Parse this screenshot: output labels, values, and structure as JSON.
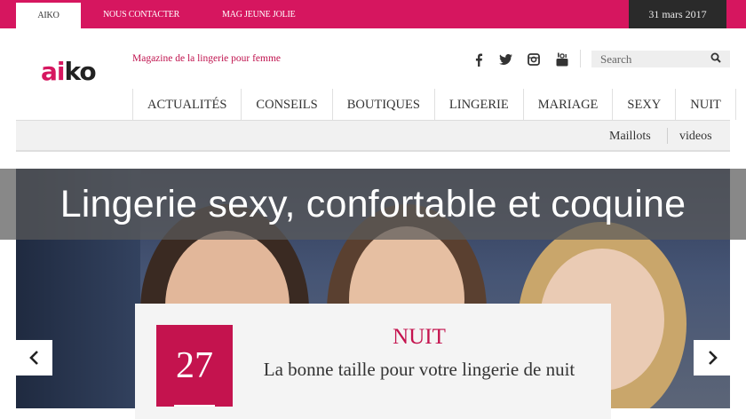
{
  "topbar": {
    "tabs": [
      {
        "label": "AIKO"
      },
      {
        "label": "NOUS CONTACTER"
      },
      {
        "label": "MAG JEUNE JOLIE"
      }
    ],
    "date": "31 mars 2017"
  },
  "header": {
    "logo": {
      "part1": "ai",
      "part2": "ko"
    },
    "tagline": "Magazine de la lingerie pour femme",
    "social": [
      {
        "icon": "facebook-icon",
        "glyph": "f"
      },
      {
        "icon": "twitter-icon",
        "glyph": "t"
      },
      {
        "icon": "instagram-icon",
        "glyph": "ig"
      },
      {
        "icon": "youtube-icon",
        "glyph": "yt"
      }
    ],
    "search": {
      "placeholder": "Search",
      "icon": "search-icon"
    }
  },
  "nav": {
    "items": [
      "ACTUALITÉS",
      "CONSEILS",
      "BOUTIQUES",
      "LINGERIE",
      "MARIAGE",
      "SEXY",
      "NUIT"
    ],
    "subitems": [
      "Maillots",
      "videos"
    ]
  },
  "hero": {
    "title": "Lingerie sexy, confortable et coquine",
    "card": {
      "number": "27",
      "category": "NUIT",
      "text": "La bonne taille pour votre lingerie de nuit"
    },
    "prev_icon": "chevron-left-icon",
    "next_icon": "chevron-right-icon"
  },
  "colors": {
    "brand": "#d6165f",
    "card_accent": "#c4134e",
    "date_bg": "#2a2a2a"
  }
}
